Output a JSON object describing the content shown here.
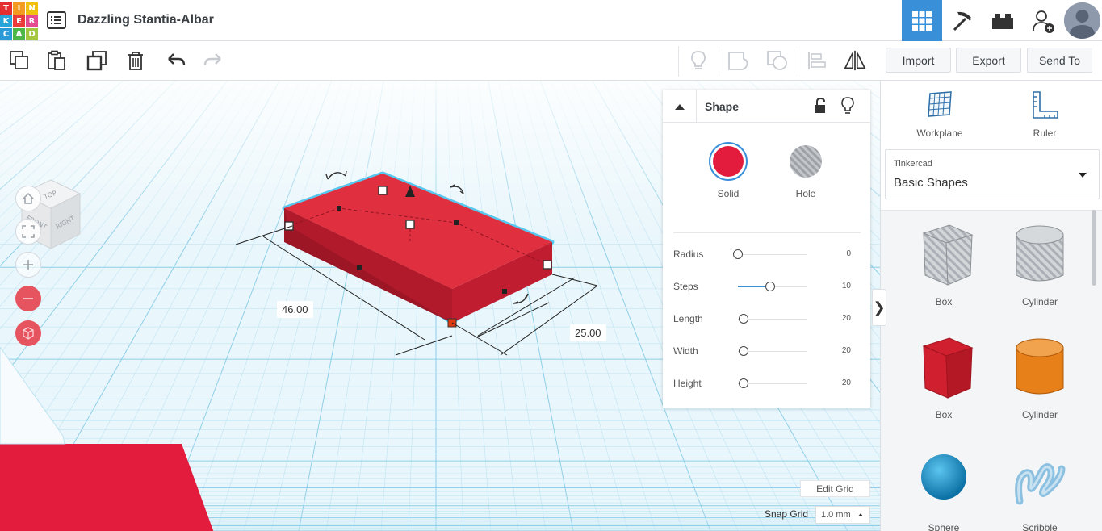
{
  "app": {
    "logo_letters": [
      "T",
      "I",
      "N",
      "K",
      "E",
      "R",
      "C",
      "A",
      "D"
    ],
    "logo_colors": [
      "#e42e30",
      "#f39a21",
      "#f2c10f",
      "#27a5d8",
      "#ea3b3b",
      "#e44a90",
      "#2b9ad6",
      "#4fb748",
      "#a5c641"
    ],
    "project_title": "Dazzling Stantia-Albar"
  },
  "topbar": {
    "icons": [
      "grid-view-icon",
      "pickaxe-icon",
      "bricks-icon",
      "add-user-icon",
      "avatar"
    ],
    "active_color": "#3a8fd9"
  },
  "toolbar": {
    "left_tools": [
      "copy-icon",
      "paste-icon",
      "duplicate-icon",
      "delete-icon",
      "undo-icon",
      "redo-icon"
    ],
    "right_tools": [
      "light-bulb-icon",
      "group-icon",
      "ungroup-icon",
      "align-icon",
      "mirror-icon"
    ],
    "import_label": "Import",
    "export_label": "Export",
    "send_to_label": "Send To"
  },
  "view_cube": {
    "top": "TOP",
    "front": "FRONT",
    "right": "RIGHT"
  },
  "dimensions": {
    "length": "46.00",
    "width": "25.00"
  },
  "inspector": {
    "title": "Shape",
    "solid_label": "Solid",
    "hole_label": "Hole",
    "solid_color": "#e31c3d",
    "properties": [
      {
        "label": "Radius",
        "value": "0",
        "fraction": 0.0
      },
      {
        "label": "Steps",
        "value": "10",
        "fraction": 0.47
      },
      {
        "label": "Length",
        "value": "20",
        "fraction": 0.08
      },
      {
        "label": "Width",
        "value": "20",
        "fraction": 0.08
      },
      {
        "label": "Height",
        "value": "20",
        "fraction": 0.08
      }
    ]
  },
  "right_panel": {
    "workplane_label": "Workplane",
    "ruler_label": "Ruler",
    "library_category": "Tinkercad",
    "library_name": "Basic Shapes",
    "shapes": [
      {
        "name": "Box",
        "kind": "box-hole",
        "color": "#b8bcc2"
      },
      {
        "name": "Cylinder",
        "kind": "cylinder-hole",
        "color": "#b8bcc2"
      },
      {
        "name": "Box",
        "kind": "box",
        "color": "#d0202f"
      },
      {
        "name": "Cylinder",
        "kind": "cylinder",
        "color": "#e8801a"
      },
      {
        "name": "Sphere",
        "kind": "sphere",
        "color": "#1a9ad6"
      },
      {
        "name": "Scribble",
        "kind": "scribble",
        "color": "#8cc0e0"
      }
    ]
  },
  "grid_controls": {
    "edit_grid_label": "Edit Grid",
    "snap_grid_label": "Snap Grid",
    "snap_value": "1.0 mm"
  }
}
